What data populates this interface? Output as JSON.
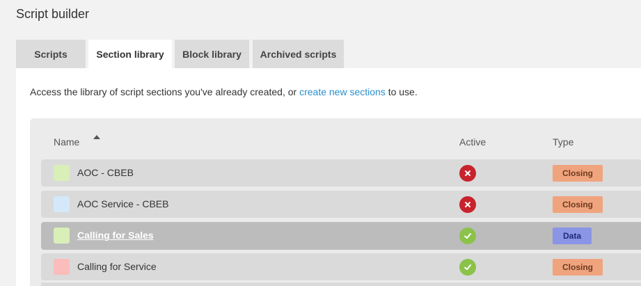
{
  "page": {
    "title": "Script builder"
  },
  "tabs": [
    {
      "label": "Scripts",
      "active": false
    },
    {
      "label": "Section library",
      "active": true
    },
    {
      "label": "Block library",
      "active": false
    },
    {
      "label": "Archived scripts",
      "active": false
    }
  ],
  "description": {
    "prefix": "Access the library of script sections you've already created, or ",
    "link": "create new sections",
    "suffix": " to use."
  },
  "table": {
    "columns": {
      "name": "Name",
      "active": "Active",
      "type": "Type"
    },
    "sort": {
      "column": "Name",
      "direction": "ascending"
    },
    "rows": [
      {
        "name": "AOC - CBEB",
        "swatch_color": "#d8efb8",
        "active": false,
        "status_icon": "x-icon",
        "type": "Closing",
        "selected": false
      },
      {
        "name": "AOC Service - CBEB",
        "swatch_color": "#d4e8fa",
        "active": false,
        "status_icon": "x-icon",
        "type": "Closing",
        "selected": false
      },
      {
        "name": "Calling for Sales",
        "swatch_color": "#d8efb8",
        "active": true,
        "status_icon": "check-icon",
        "type": "Data",
        "selected": true
      },
      {
        "name": "Calling for Service",
        "swatch_color": "#fbbcbc",
        "active": true,
        "status_icon": "check-icon",
        "type": "Closing",
        "selected": false
      }
    ]
  },
  "colors": {
    "link": "#2a8fd0",
    "inactive_status": "#c8232c",
    "active_status": "#8bc34a",
    "closing_badge": "#f0a47e",
    "data_badge": "#8a95e6"
  }
}
